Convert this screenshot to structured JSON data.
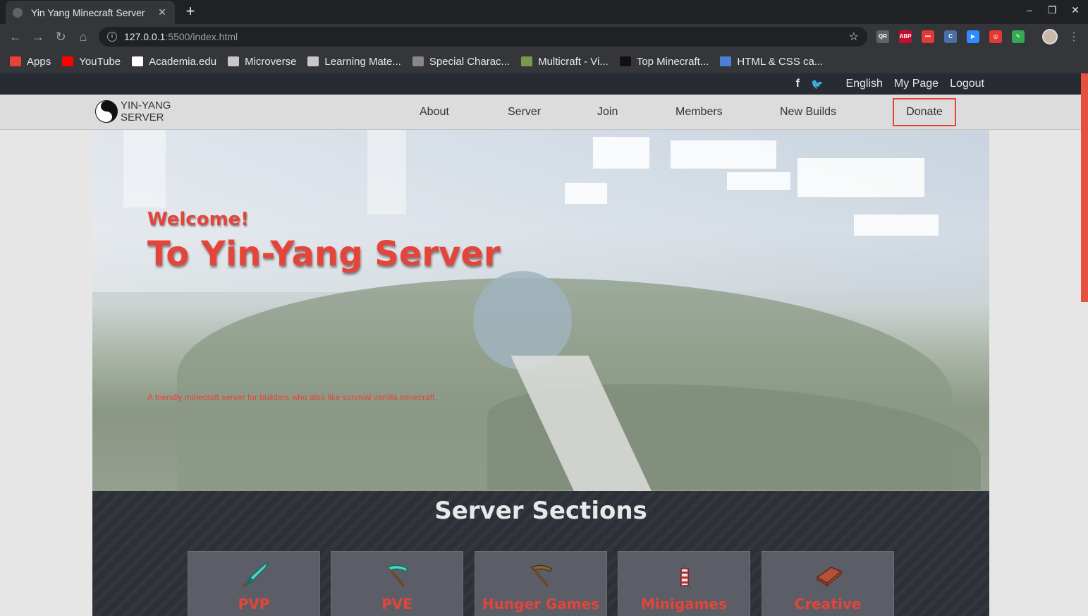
{
  "browser": {
    "tab_title": "Yin Yang Minecraft Server",
    "tab_close": "✕",
    "new_tab": "+",
    "minimize": "–",
    "restore": "❐",
    "close": "✕",
    "back": "←",
    "forward": "→",
    "reload": "↻",
    "home": "⌂",
    "url_host": "127.0.0.1",
    "url_path": ":5500/index.html",
    "bookmark_star": "☆",
    "menu": "⋮",
    "extensions": [
      {
        "name": "qr-extension-icon",
        "text": "QR",
        "color": "#5f6368"
      },
      {
        "name": "adblock-icon",
        "text": "ABP",
        "color": "#c70d2c"
      },
      {
        "name": "extension-red-icon",
        "text": "•••",
        "color": "#e53935"
      },
      {
        "name": "extension-c-icon",
        "text": "C",
        "color": "#4a6fa5"
      },
      {
        "name": "zoom-icon",
        "text": "▶",
        "color": "#2d8cff"
      },
      {
        "name": "extension-ring-icon",
        "text": "◎",
        "color": "#e53935"
      },
      {
        "name": "extension-pen-icon",
        "text": "✎",
        "color": "#34a853"
      }
    ],
    "bookmarks": [
      {
        "name": "bookmark-apps",
        "label": "Apps",
        "color": "#ea4335"
      },
      {
        "name": "bookmark-youtube",
        "label": "YouTube",
        "color": "#ff0000"
      },
      {
        "name": "bookmark-academia",
        "label": "Academia.edu",
        "color": "#ffffff"
      },
      {
        "name": "bookmark-microverse",
        "label": "Microverse",
        "color": "#c8c8c8"
      },
      {
        "name": "bookmark-learning",
        "label": "Learning Mate...",
        "color": "#c8c8c8"
      },
      {
        "name": "bookmark-special-chars",
        "label": "Special Charac...",
        "color": "#888888"
      },
      {
        "name": "bookmark-multicraft",
        "label": "Multicraft - Vi...",
        "color": "#7a9a4a"
      },
      {
        "name": "bookmark-top-minecraft",
        "label": "Top Minecraft...",
        "color": "#111111"
      },
      {
        "name": "bookmark-html-css",
        "label": "HTML & CSS ca...",
        "color": "#4a7fd4"
      }
    ]
  },
  "topbar": {
    "facebook": "f",
    "twitter": "🐦",
    "language": "English",
    "my_page": "My Page",
    "logout": "Logout"
  },
  "nav": {
    "logo_line1": "YIN-YANG",
    "logo_line2": "SERVER",
    "links": [
      "About",
      "Server",
      "Join",
      "Members",
      "New Builds"
    ],
    "donate": "Donate"
  },
  "hero": {
    "welcome": "Welcome!",
    "title": "To Yin-Yang Server",
    "tagline": "A friendly minecraft server for builders who also like survival vanilla minecraft."
  },
  "sections": {
    "title": "Server Sections",
    "cards": [
      {
        "name": "pvp",
        "label": "PVP",
        "icon": "diamond-sword-icon"
      },
      {
        "name": "pve",
        "label": "PVE",
        "icon": "diamond-pickaxe-icon"
      },
      {
        "name": "hunger-games",
        "label": "Hunger Games",
        "icon": "wooden-pickaxe-icon"
      },
      {
        "name": "minigames",
        "label": "Minigames",
        "icon": "firework-icon"
      },
      {
        "name": "creative",
        "label": "Creative",
        "icon": "brick-icon"
      }
    ]
  },
  "colors": {
    "accent": "#e5443a",
    "topbar": "#272b33",
    "nav": "#dcdcdc",
    "sections_bg": "#2e3038"
  }
}
